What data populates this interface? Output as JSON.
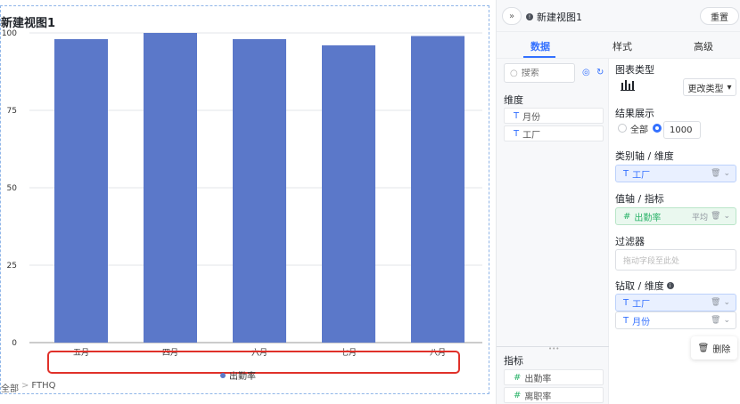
{
  "chart_title": "新建视图1",
  "chart_data": {
    "type": "bar",
    "categories": [
      "五月",
      "四月",
      "六月",
      "七月",
      "八月"
    ],
    "series": [
      {
        "name": "出勤率",
        "values": [
          98,
          100,
          98,
          96,
          99
        ]
      }
    ],
    "yticks": [
      0,
      25,
      50,
      75,
      100
    ],
    "ylim": [
      0,
      100
    ],
    "grid": true,
    "legend": "bottom",
    "bar_color": "#5b78c9"
  },
  "legend_label": "出勤率",
  "breadcrumb": {
    "root": "全部",
    "sep": ">",
    "current": "FTHQ"
  },
  "panel": {
    "view_name": "新建视图1",
    "reset_label": "重置",
    "tabs": [
      "数据",
      "样式",
      "高级"
    ],
    "search_placeholder": "搜索",
    "dimension_label": "维度",
    "dimensions": [
      "月份",
      "工厂"
    ],
    "metric_label": "指标",
    "metrics": [
      "出勤率",
      "离职率"
    ],
    "chart_type_label": "图表类型",
    "change_type_label": "更改类型",
    "result_label": "结果展示",
    "all_label": "全部",
    "limit_value": "1000",
    "category_axis_label": "类别轴 / 维度",
    "category_axis_field": "工厂",
    "value_axis_label": "值轴 / 指标",
    "value_axis_field": "出勤率",
    "value_axis_agg": "平均",
    "filter_label": "过滤器",
    "filter_placeholder": "拖动字段至此处",
    "drill_label": "钻取 / 维度",
    "drill_fields": [
      "工厂",
      "月份"
    ],
    "delete_label": "删除"
  }
}
